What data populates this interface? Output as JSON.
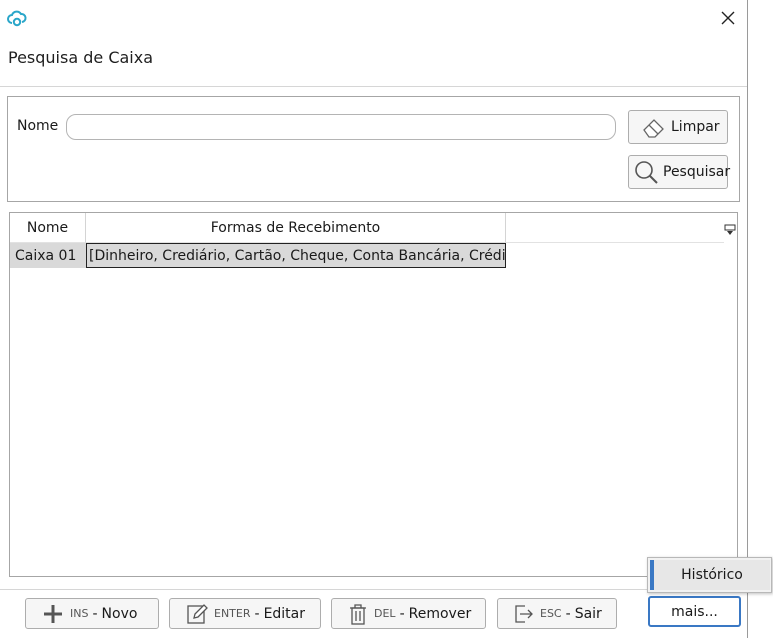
{
  "window": {
    "title": "Pesquisa de Caixa"
  },
  "filter": {
    "name_label": "Nome",
    "name_value": "",
    "clear_label": "Limpar",
    "search_label": "Pesquisar"
  },
  "grid": {
    "columns": [
      "Nome",
      "Formas de Recebimento"
    ],
    "rows": [
      {
        "nome": "Caixa 01",
        "formas": "[Dinheiro, Crediário, Cartão, Cheque, Conta Bancária, Crédito]"
      }
    ]
  },
  "footer": {
    "novo": {
      "key": "INS",
      "label": "Novo"
    },
    "editar": {
      "key": "ENTER",
      "label": "Editar"
    },
    "remover": {
      "key": "DEL",
      "label": "Remover"
    },
    "sair": {
      "key": "ESC",
      "label": "Sair"
    },
    "mais": "mais...",
    "separator": "-"
  },
  "popup": {
    "historico": "Histórico"
  },
  "colors": {
    "accent": "#3a78c4",
    "app_icon": "#2aa6c9",
    "selection": "#d9d9d9"
  },
  "icons": [
    "cloud-logo-icon",
    "close-icon",
    "eraser-icon",
    "search-icon",
    "column-chooser-icon",
    "plus-icon",
    "edit-icon",
    "trash-icon",
    "exit-icon"
  ]
}
